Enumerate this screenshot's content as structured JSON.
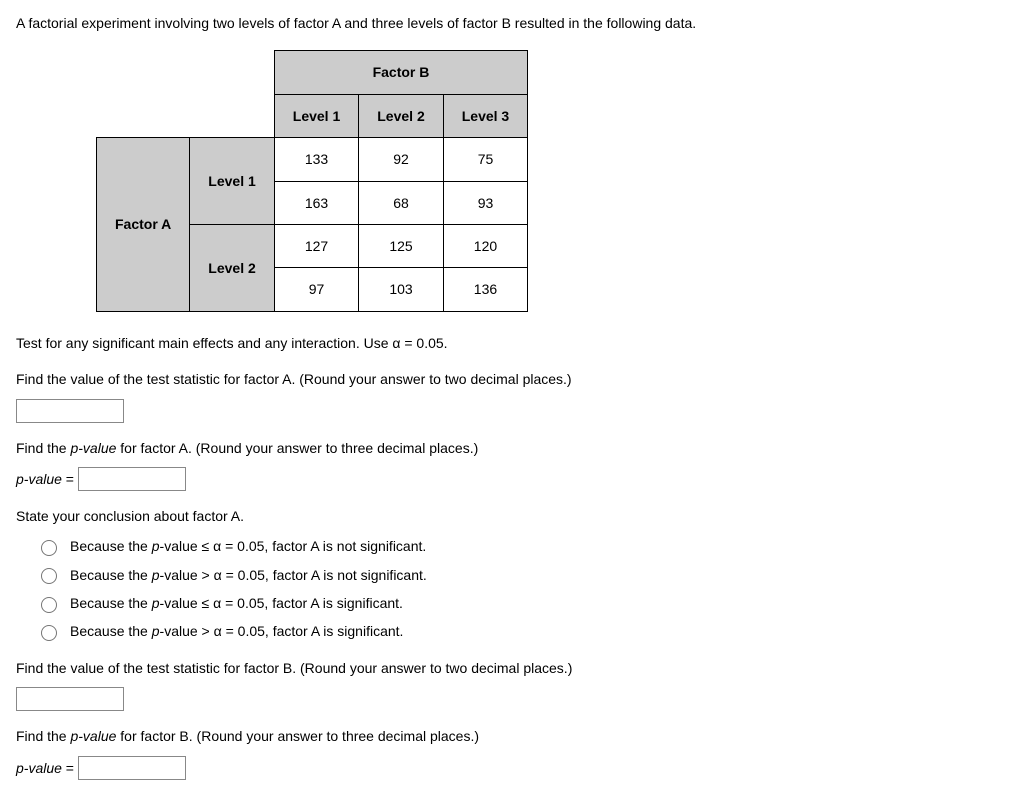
{
  "intro": "A factorial experiment involving two levels of factor A and three levels of factor B resulted in the following data.",
  "table": {
    "factorB_header": "Factor B",
    "factorA_header": "Factor A",
    "b_levels": [
      "Level 1",
      "Level 2",
      "Level 3"
    ],
    "a_levels": [
      "Level 1",
      "Level 2"
    ],
    "rows": [
      [
        "133",
        "92",
        "75"
      ],
      [
        "163",
        "68",
        "93"
      ],
      [
        "127",
        "125",
        "120"
      ],
      [
        "97",
        "103",
        "136"
      ]
    ]
  },
  "q_test_instructions": "Test for any significant main effects and any interaction. Use α = 0.05.",
  "q_factorA_stat": "Find the value of the test statistic for factor A. (Round your answer to two decimal places.)",
  "q_factorA_pval_prefix": "Find the ",
  "q_factorA_pval_suffix": " for factor A. (Round your answer to three decimal places.)",
  "pvalue_label": "p-value",
  "equals_label": " = ",
  "q_conclusionA_prompt": "State your conclusion about factor A.",
  "radio_optionsA": [
    {
      "pre": "Because the ",
      "pv": "p",
      "mid": "-value ≤ α = 0.05, factor A is not significant."
    },
    {
      "pre": "Because the ",
      "pv": "p",
      "mid": "-value > α = 0.05, factor A is not significant."
    },
    {
      "pre": "Because the ",
      "pv": "p",
      "mid": "-value ≤ α = 0.05, factor A is significant."
    },
    {
      "pre": "Because the ",
      "pv": "p",
      "mid": "-value > α = 0.05, factor A is significant."
    }
  ],
  "q_factorB_stat": "Find the value of the test statistic for factor B. (Round your answer to two decimal places.)",
  "q_factorB_pval_prefix": "Find the ",
  "q_factorB_pval_suffix": " for factor B. (Round your answer to three decimal places.)"
}
